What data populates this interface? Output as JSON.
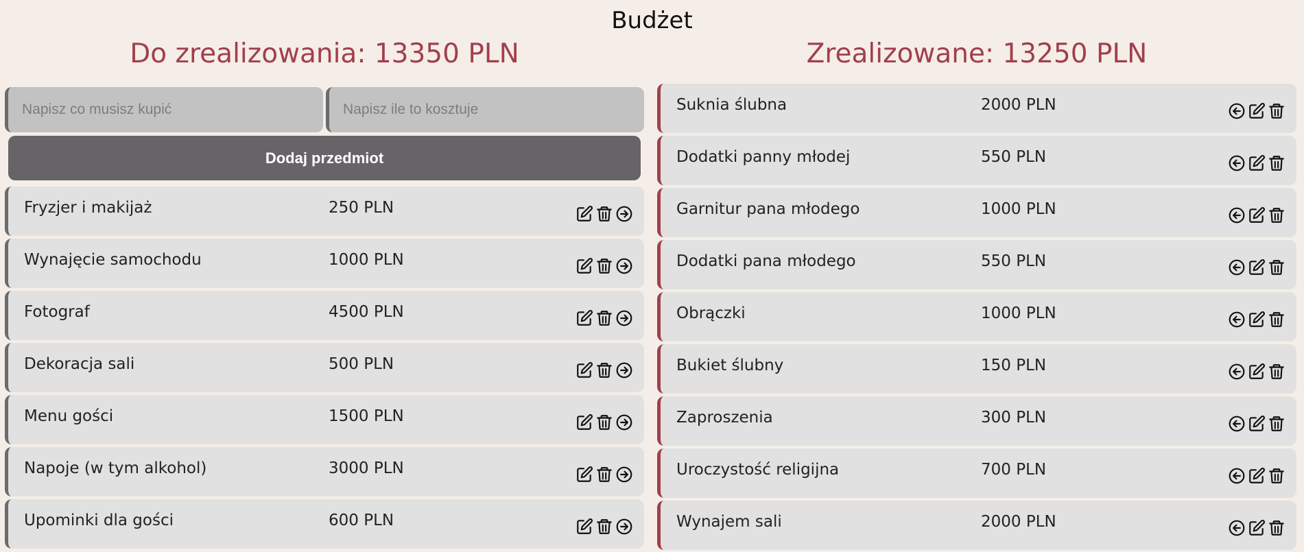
{
  "page": {
    "title": "Budżet"
  },
  "left": {
    "heading": "Do zrealizowania: 13350 PLN",
    "name_placeholder": "Napisz co musisz kupić",
    "price_placeholder": "Napisz ile to kosztuje",
    "add_button_label": "Dodaj przedmiot",
    "items": [
      {
        "name": "Fryzjer i makijaż",
        "price": "250 PLN"
      },
      {
        "name": "Wynajęcie samochodu",
        "price": "1000 PLN"
      },
      {
        "name": "Fotograf",
        "price": "4500 PLN"
      },
      {
        "name": "Dekoracja sali",
        "price": "500 PLN"
      },
      {
        "name": "Menu gości",
        "price": "1500 PLN"
      },
      {
        "name": "Napoje (w tym alkohol)",
        "price": "3000 PLN"
      },
      {
        "name": "Upominki dla gości",
        "price": "600 PLN"
      }
    ],
    "item_icons": [
      "edit-icon",
      "trash-icon",
      "arrow-right-circle-icon"
    ]
  },
  "right": {
    "heading": "Zrealizowane: 13250 PLN",
    "items": [
      {
        "name": "Suknia ślubna",
        "price": "2000 PLN"
      },
      {
        "name": "Dodatki panny młodej",
        "price": "550 PLN"
      },
      {
        "name": "Garnitur pana młodego",
        "price": "1000 PLN"
      },
      {
        "name": "Dodatki pana młodego",
        "price": "550 PLN"
      },
      {
        "name": "Obrączki",
        "price": "1000 PLN"
      },
      {
        "name": "Bukiet ślubny",
        "price": "150 PLN"
      },
      {
        "name": "Zaproszenia",
        "price": "300 PLN"
      },
      {
        "name": "Uroczystość religijna",
        "price": "700 PLN"
      },
      {
        "name": "Wynajem sali",
        "price": "2000 PLN"
      }
    ],
    "item_icons": [
      "arrow-left-circle-icon",
      "edit-icon",
      "trash-icon"
    ]
  },
  "colors": {
    "background": "#f5eee8",
    "accent": "#a23f4c",
    "card": "#e1e1e1",
    "button": "#676468"
  }
}
